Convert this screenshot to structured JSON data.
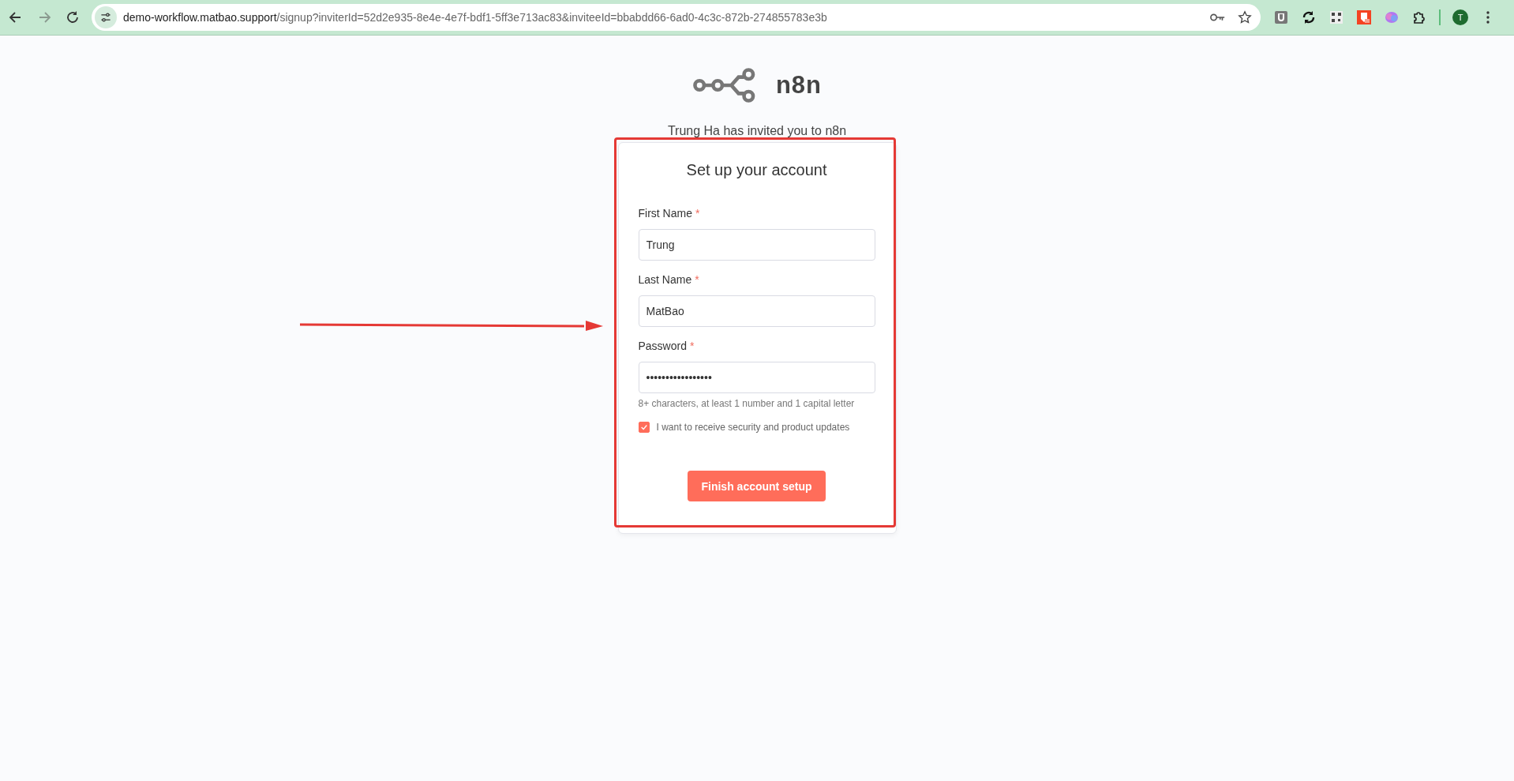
{
  "browser": {
    "url_host": "demo-workflow.matbao.support",
    "url_path": "/signup?inviterId=52d2e935-8e4e-4e7f-bdf1-5ff3e713ac83&inviteeId=bbabdd66-6ad0-4c3c-872b-274855783e3b",
    "profile_initial": "T"
  },
  "logo": {
    "text": "n8n"
  },
  "invite_text": "Trung Ha has invited you to n8n",
  "card": {
    "title": "Set up your account",
    "fields": [
      {
        "label": "First Name",
        "required_mark": "*",
        "value": "Trung"
      },
      {
        "label": "Last Name",
        "required_mark": "*",
        "value": "MatBao"
      },
      {
        "label": "Password",
        "required_mark": "*",
        "value": "•••••••••••••••••",
        "hint": "8+ characters, at least 1 number and 1 capital letter"
      }
    ],
    "checkbox": {
      "label": "I want to receive security and product updates",
      "checked": true
    },
    "button": "Finish account setup"
  },
  "annotations": {
    "arrow": true,
    "highlight_box": true
  }
}
